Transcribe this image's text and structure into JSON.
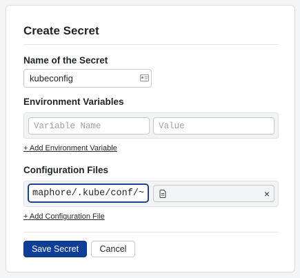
{
  "dialog": {
    "title": "Create Secret"
  },
  "secret_name": {
    "label": "Name of the Secret",
    "value": "kubeconfig",
    "icon": "id-card-icon"
  },
  "env_vars": {
    "label": "Environment Variables",
    "name_placeholder": "Variable Name",
    "value_placeholder": "Value",
    "add_link": "+ Add Environment Variable"
  },
  "config_files": {
    "label": "Configuration Files",
    "path_value": "~/semaphore/.kube/conf",
    "file_icon": "document-icon",
    "remove_label": "×",
    "add_link": "+ Add Configuration File"
  },
  "actions": {
    "save_label": "Save Secret",
    "cancel_label": "Cancel"
  },
  "colors": {
    "primary": "#0f3e99",
    "focus_border": "#1f3f93"
  }
}
